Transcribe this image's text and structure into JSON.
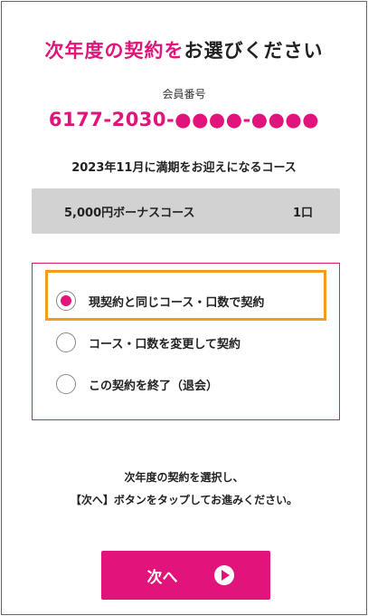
{
  "header": {
    "title_accent": "次年度の契約を",
    "title_rest": "お選びください"
  },
  "member": {
    "label": "会員番号",
    "number": "6177-2030-●●●●-●●●●"
  },
  "notice": "2023年11月に満期をお迎えになるコース",
  "course": {
    "name": "5,000円ボーナスコース",
    "units": "1口"
  },
  "options": [
    {
      "label": "現契約と同じコース・口数で契約",
      "selected": true
    },
    {
      "label": "コース・口数を変更して契約",
      "selected": false
    },
    {
      "label": "この契約を終了（退会）",
      "selected": false
    }
  ],
  "instruction": {
    "line1": "次年度の契約を選択し、",
    "line2": "【次へ】ボタンをタップしてお進みください。"
  },
  "next_button": {
    "label": "次へ",
    "icon": "play-circle-icon"
  },
  "colors": {
    "accent": "#e0147a",
    "highlight": "#f39c1f",
    "course_bg": "#d2d2d2"
  }
}
